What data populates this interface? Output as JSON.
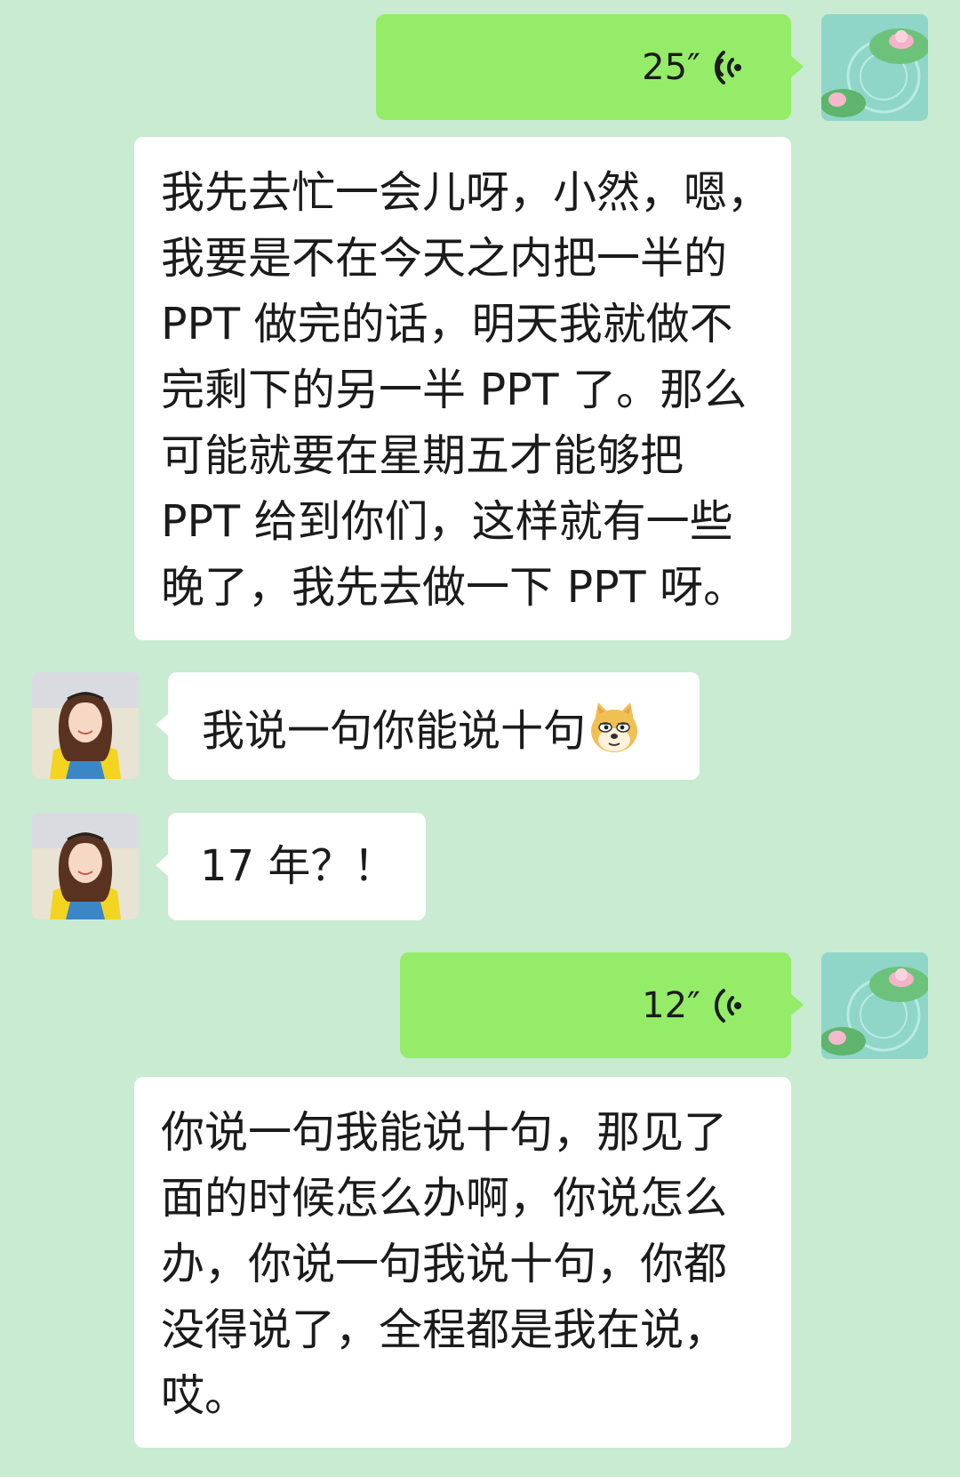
{
  "messages": [
    {
      "side": "self",
      "kind": "voice",
      "duration": "25″"
    },
    {
      "side": "self",
      "kind": "transcript",
      "lines": [
        "我先去忙一会儿呀，小然，嗯，",
        "我要是不在今天之内把一半的",
        "PPT 做完的话，明天我就做不",
        "完剩下的另一半 PPT 了。那么",
        "可能就要在星期五才能够把",
        "PPT 给到你们，这样就有一些",
        "晚了，我先去做一下 PPT 呀。"
      ]
    },
    {
      "side": "other",
      "kind": "text",
      "text": "我说一句你能说十句",
      "emoji": "doge-emoji"
    },
    {
      "side": "other",
      "kind": "text",
      "text": "17 年？！"
    },
    {
      "side": "self",
      "kind": "voice",
      "duration": "12″"
    },
    {
      "side": "self",
      "kind": "transcript",
      "lines": [
        "你说一句我能说十句，那见了",
        "面的时候怎么办啊，你说怎么",
        "办，你说一句我说十句，你都",
        "没得说了，全程都是我在说，",
        "哎。"
      ]
    }
  ],
  "colors": {
    "background": "#c8ebd2",
    "self_bubble": "#95ec69",
    "other_bubble": "#ffffff",
    "text": "#1b1b1b"
  },
  "icons": {
    "voice": "voice-wave-icon",
    "self_avatar": "lotus-pond-avatar",
    "other_avatar": "girl-photo-avatar",
    "emoji": "doge-emoji"
  }
}
